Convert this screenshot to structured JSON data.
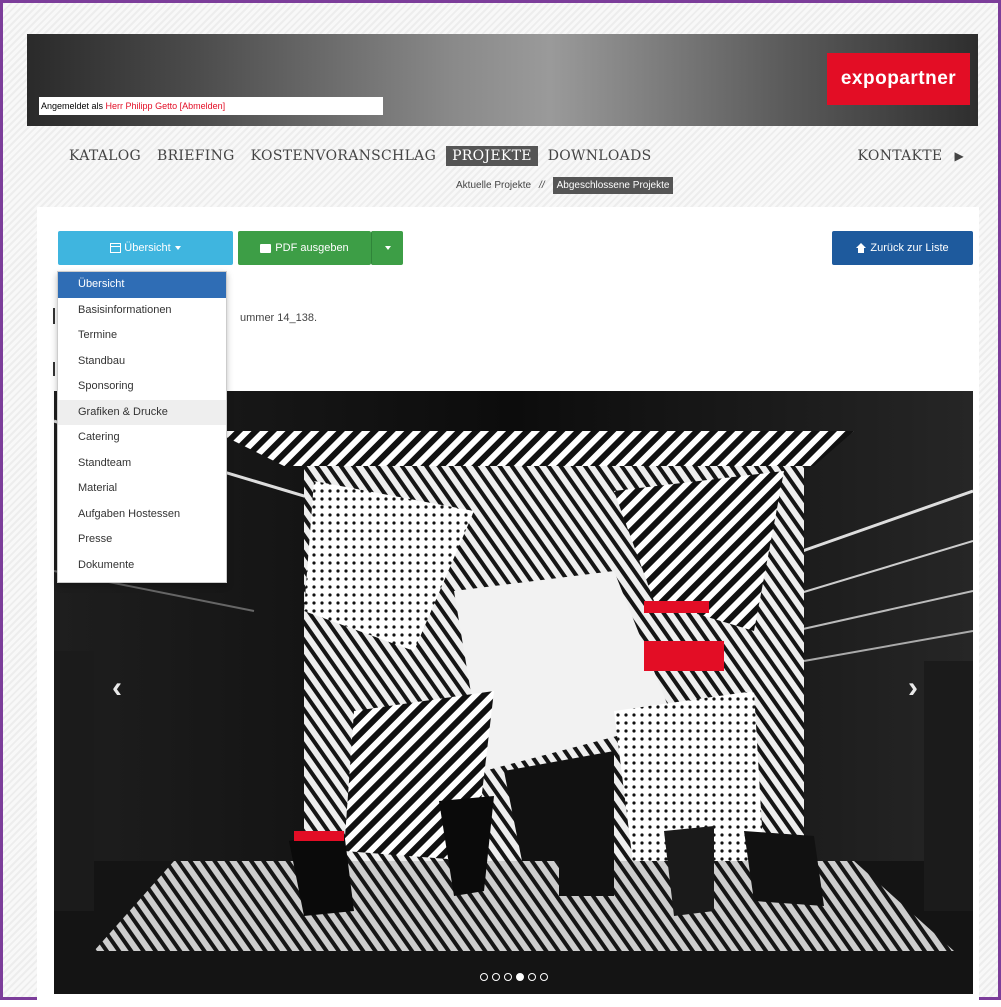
{
  "header": {
    "brand": "expopartner",
    "login_prefix": "Angemeldet als ",
    "login_user": "Herr Philipp Getto",
    "login_logout": "[Abmelden]"
  },
  "nav": {
    "items": [
      "KATALOG",
      "BRIEFING",
      "KOSTENVORANSCHLAG",
      "PROJEKTE",
      "DOWNLOADS"
    ],
    "active": "PROJEKTE",
    "right": "KONTAKTE",
    "right_icon": "triangle-right-icon"
  },
  "subnav": {
    "current": "Aktuelle Projekte",
    "separator": "//",
    "completed": "Abgeschlossene Projekte"
  },
  "toolbar": {
    "overview_label": "Übersicht",
    "pdf_label": "PDF ausgeben",
    "back_label": "Zurück zur Liste"
  },
  "project_info": "ummer 14_138.",
  "dropdown": {
    "items": [
      "Übersicht",
      "Basisinformationen",
      "Termine",
      "Standbau",
      "Sponsoring",
      "Grafiken & Drucke",
      "Catering",
      "Standteam",
      "Material",
      "Aufgaben Hostessen",
      "Presse",
      "Dokumente"
    ],
    "active_index": 0,
    "hover_index": 5
  },
  "slider": {
    "slide_count": 6,
    "active_slide_index": 3
  },
  "colors": {
    "brand_red": "#e30d25",
    "frame_purple": "#7c3d9a",
    "overview_button": "#3fb5df",
    "pdf_button": "#3d9e46",
    "back_button": "#1e5a9d",
    "dropdown_active": "#2f6db5"
  }
}
